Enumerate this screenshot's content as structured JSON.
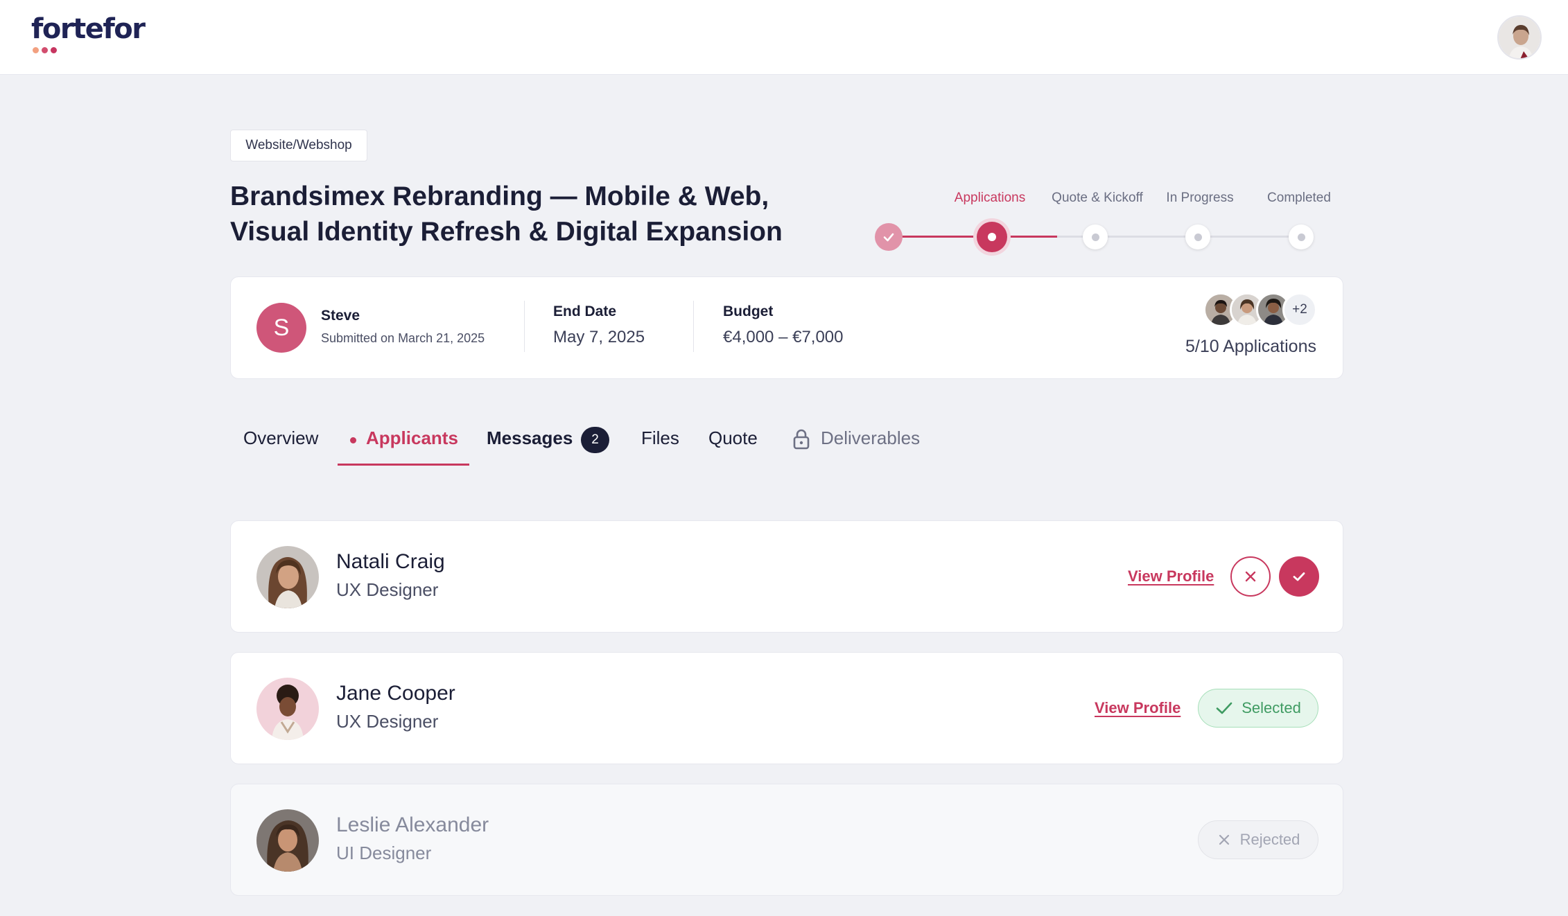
{
  "header": {
    "logo_text": "fortefor",
    "logo_dot_colors": [
      "#f2a080",
      "#d24d6e",
      "#c73560"
    ],
    "avatar_icon": "user-avatar-icon"
  },
  "project": {
    "category": "Website/Webshop",
    "title_line1": "Brandsimex Rebranding — Mobile & Web,",
    "title_line2": "Visual Identity Refresh & Digital Expansion"
  },
  "stepper": {
    "steps": [
      {
        "label": "",
        "state": "done"
      },
      {
        "label": "Applications",
        "state": "active"
      },
      {
        "label": "Quote & Kickoff",
        "state": "pending"
      },
      {
        "label": "In Progress",
        "state": "pending"
      },
      {
        "label": "Completed",
        "state": "pending"
      }
    ]
  },
  "summary": {
    "client_initial": "S",
    "client_name": "Steve",
    "submitted": "Submitted on March 21, 2025",
    "end_date_label": "End Date",
    "end_date": "May 7, 2025",
    "budget_label": "Budget",
    "budget": "€4,000 – €7,000",
    "more_applicants": "+2",
    "applications": "5/10 Applications"
  },
  "tabs": {
    "overview": "Overview",
    "applicants": "Applicants",
    "messages": "Messages",
    "messages_count": "2",
    "files": "Files",
    "quote": "Quote",
    "deliverables": "Deliverables"
  },
  "applicants": [
    {
      "name": "Natali Craig",
      "role": "UX Designer",
      "link": "View Profile",
      "status": "pending"
    },
    {
      "name": "Jane Cooper",
      "role": "UX Designer",
      "link": "View Profile",
      "status": "selected",
      "status_label": "Selected"
    },
    {
      "name": "Leslie Alexander",
      "role": "UI Designer",
      "status": "rejected",
      "status_label": "Rejected"
    }
  ],
  "colors": {
    "accent": "#c8385e",
    "navy": "#1f2355",
    "success": "#3f9b62",
    "background": "#f0f1f5"
  }
}
